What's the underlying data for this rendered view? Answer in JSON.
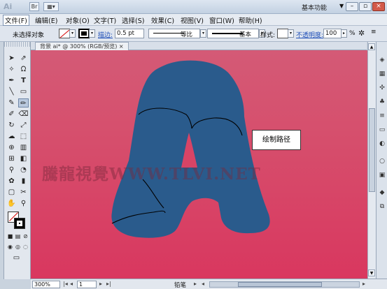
{
  "app": {
    "logo": "Ai",
    "workspace_label": "基本功能"
  },
  "menu": [
    "文件(F)",
    "编辑(E)",
    "对象(O)",
    "文字(T)",
    "选择(S)",
    "效果(C)",
    "视图(V)",
    "窗口(W)",
    "帮助(H)"
  ],
  "control": {
    "selection_label": "未选择对象",
    "stroke_link": "描边:",
    "stroke_weight": "0.5 pt",
    "profile_label": "等比",
    "brush_label": "基本",
    "style_label": "样式:",
    "opacity_link": "不透明度:",
    "opacity_value": "100",
    "opacity_unit": "%"
  },
  "document": {
    "tab_title": "背景 ai* @ 300% (RGB/预览)"
  },
  "canvas": {
    "callout": "绘制路径",
    "watermark": "騰龍視覺WWW.TLVI.NET",
    "letter_color": "#2a5b8c",
    "background_color": "#d6446a"
  },
  "status": {
    "zoom": "300%",
    "page": "1",
    "tool_name": "铅笔"
  },
  "icons": {
    "titlebar": [
      "bridge-icon",
      "arrange-documents-icon"
    ],
    "window": [
      "minimize-icon",
      "restore-icon",
      "close-icon"
    ]
  }
}
